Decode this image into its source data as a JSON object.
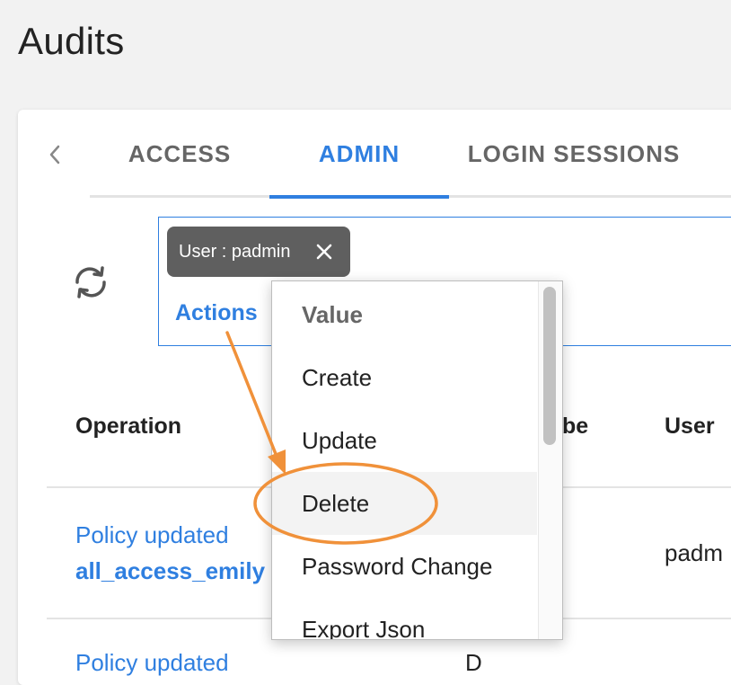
{
  "page": {
    "title": "Audits"
  },
  "tabs": [
    {
      "label": "ACCESS",
      "active": false
    },
    {
      "label": "ADMIN",
      "active": true
    },
    {
      "label": "LOGIN SESSIONS",
      "active": false
    }
  ],
  "filter": {
    "chip_label": "User : padmin",
    "actions_label": "Actions"
  },
  "table": {
    "columns": [
      "Operation",
      "be",
      "User"
    ],
    "rows": [
      {
        "operation": "Policy updated",
        "name": "all_access_emily",
        "user": "padm"
      },
      {
        "operation": "Policy updated",
        "type": "D"
      }
    ]
  },
  "dropdown": {
    "items": [
      "Value",
      "Create",
      "Update",
      "Delete",
      "Password Change",
      "Export Json"
    ],
    "highlighted": "Delete"
  },
  "icons": {
    "tab_prev": "chevron-left-icon",
    "refresh": "refresh-icon",
    "chip_close": "close-icon"
  },
  "colors": {
    "accent": "#2f7fe0",
    "annotation": "#f0913a",
    "chip_bg": "#5f5f5f"
  }
}
